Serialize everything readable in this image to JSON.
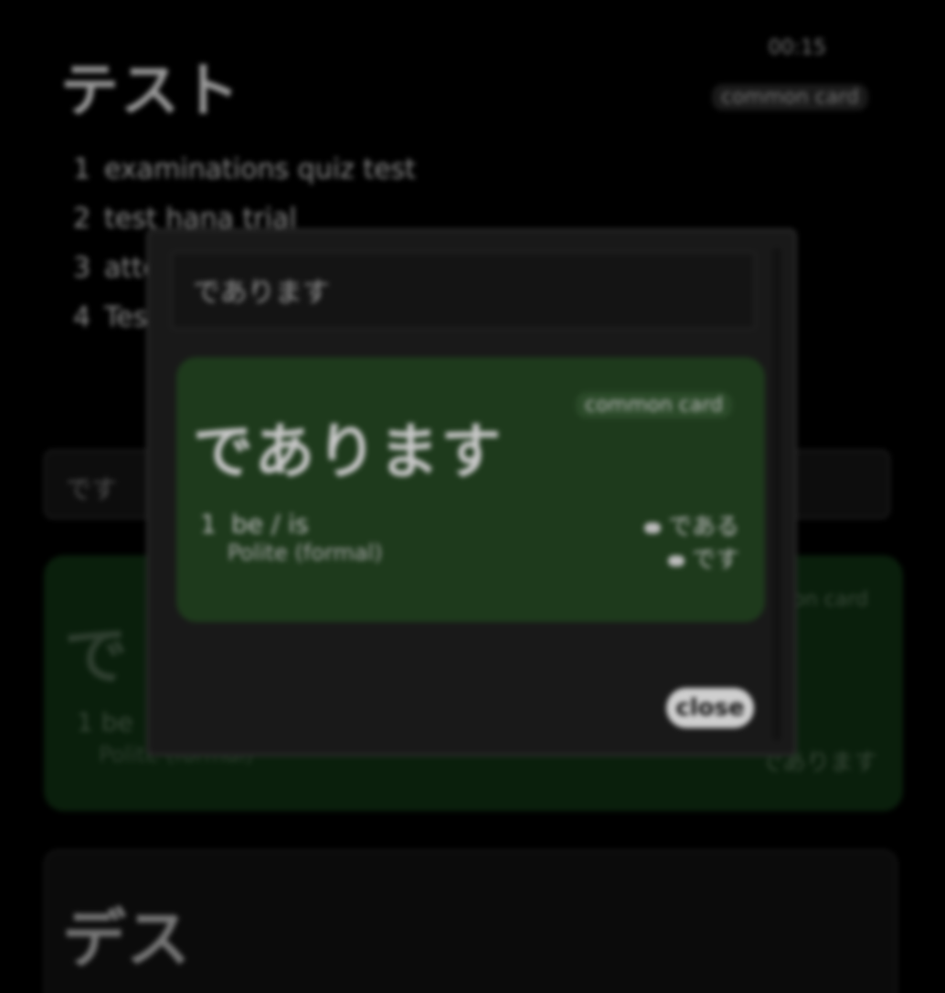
{
  "background": {
    "title": "テスト",
    "meta_top": "00:15",
    "meta_tag": "common card",
    "list": [
      {
        "num": "1",
        "text": "examinations quiz test"
      },
      {
        "num": "2",
        "text": "test hana trial"
      },
      {
        "num": "3",
        "text": "attempt"
      },
      {
        "num": "4",
        "text": "Test"
      }
    ],
    "search_value": "です",
    "green_card": {
      "title": "で",
      "tag": "common card",
      "item_num": "1",
      "item_text": "be",
      "sub_text": "Polite (formal)",
      "right_text": "であります"
    },
    "dark_card": {
      "title": "デス"
    }
  },
  "modal": {
    "header_text": "であります",
    "result": {
      "title": "であります",
      "tag": "common card",
      "item_num": "1",
      "item_text": "be / is",
      "sub_text": "Polite (formal)",
      "right_lines": [
        "である",
        "です"
      ]
    },
    "close_label": "close"
  }
}
